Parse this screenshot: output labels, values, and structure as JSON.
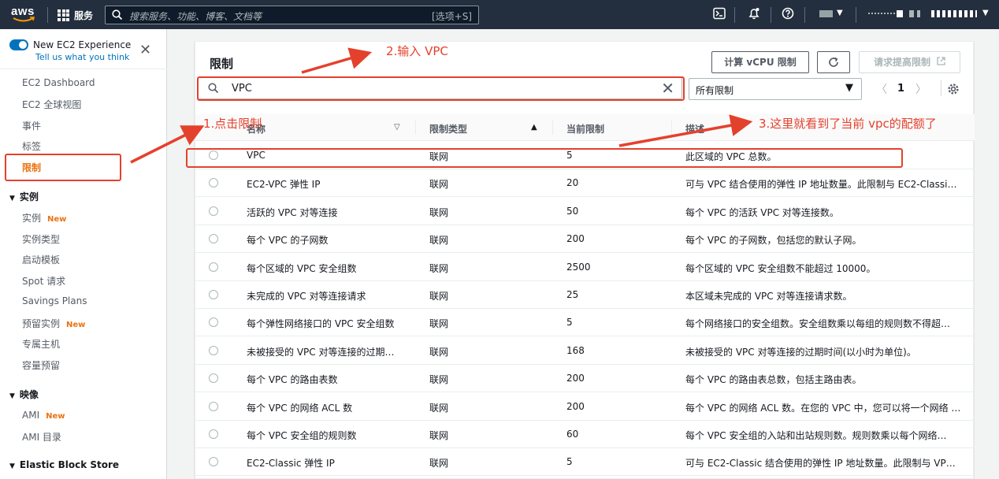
{
  "topbar": {
    "logo": "aws",
    "services_label": "服务",
    "search_placeholder": "搜索服务、功能、博客、文档等",
    "search_shortcut": "[选项+S]"
  },
  "sidebar": {
    "experience_title": "New EC2 Experience",
    "experience_link": "Tell us what you think",
    "items": [
      {
        "label": "EC2 Dashboard"
      },
      {
        "label": "EC2 全球视图"
      },
      {
        "label": "事件"
      },
      {
        "label": "标签"
      },
      {
        "label": "限制"
      }
    ],
    "sections": [
      {
        "title": "实例",
        "items": [
          {
            "label": "实例",
            "badge": "New"
          },
          {
            "label": "实例类型"
          },
          {
            "label": "启动模板"
          },
          {
            "label": "Spot 请求"
          },
          {
            "label": "Savings Plans"
          },
          {
            "label": "预留实例",
            "badge": "New"
          },
          {
            "label": "专属主机"
          },
          {
            "label": "容量预留"
          }
        ]
      },
      {
        "title": "映像",
        "items": [
          {
            "label": "AMI",
            "badge": "New"
          },
          {
            "label": "AMI 目录"
          }
        ]
      },
      {
        "title": "Elastic Block Store",
        "items": []
      }
    ]
  },
  "main": {
    "title": "限制",
    "buttons": {
      "vcpu": "计算 vCPU 限制",
      "request": "请求提高限制"
    },
    "search_value": "VPC",
    "filter_selected": "所有限制",
    "page": "1",
    "columns": [
      "名称",
      "限制类型",
      "当前限制",
      "描述"
    ],
    "rows": [
      {
        "name": "VPC",
        "type": "联网",
        "limit": "5",
        "desc": "此区域的 VPC 总数。"
      },
      {
        "name": "EC2-VPC 弹性 IP",
        "type": "联网",
        "limit": "20",
        "desc": "可与 VPC 结合使用的弹性 IP 地址数量。此限制与 EC2-Classic…"
      },
      {
        "name": "活跃的 VPC 对等连接",
        "type": "联网",
        "limit": "50",
        "desc": "每个 VPC 的活跃 VPC 对等连接数。"
      },
      {
        "name": "每个 VPC 的子网数",
        "type": "联网",
        "limit": "200",
        "desc": "每个 VPC 的子网数，包括您的默认子网。"
      },
      {
        "name": "每个区域的 VPC 安全组数",
        "type": "联网",
        "limit": "2500",
        "desc": "每个区域的 VPC 安全组数不能超过 10000。"
      },
      {
        "name": "未完成的 VPC 对等连接请求",
        "type": "联网",
        "limit": "25",
        "desc": "本区域未完成的 VPC 对等连接请求数。"
      },
      {
        "name": "每个弹性网络接口的 VPC 安全组数",
        "type": "联网",
        "limit": "5",
        "desc": "每个网络接口的安全组数。安全组数乘以每组的规则数不得超…"
      },
      {
        "name": "未被接受的 VPC 对等连接的过期…",
        "type": "联网",
        "limit": "168",
        "desc": "未被接受的 VPC 对等连接的过期时间(以小时为单位)。"
      },
      {
        "name": "每个 VPC 的路由表数",
        "type": "联网",
        "limit": "200",
        "desc": "每个 VPC 的路由表总数，包括主路由表。"
      },
      {
        "name": "每个 VPC 的网络 ACL 数",
        "type": "联网",
        "limit": "200",
        "desc": "每个 VPC 的网络 ACL 数。在您的 VPC 中，您可以将一个网络 …"
      },
      {
        "name": "每个 VPC 安全组的规则数",
        "type": "联网",
        "limit": "60",
        "desc": "每个 VPC 安全组的入站和出站规则数。规则数乘以每个网络…"
      },
      {
        "name": "EC2-Classic 弹性 IP",
        "type": "联网",
        "limit": "5",
        "desc": "可与 EC2-Classic 结合使用的弹性 IP 地址数量。此限制与 VPC…"
      }
    ]
  },
  "annotations": {
    "step1": "1.点击限制",
    "step2": "2.输入 VPC",
    "step3": "3.这里就看到了当前 vpc的配额了",
    "color": "#e4412d"
  }
}
